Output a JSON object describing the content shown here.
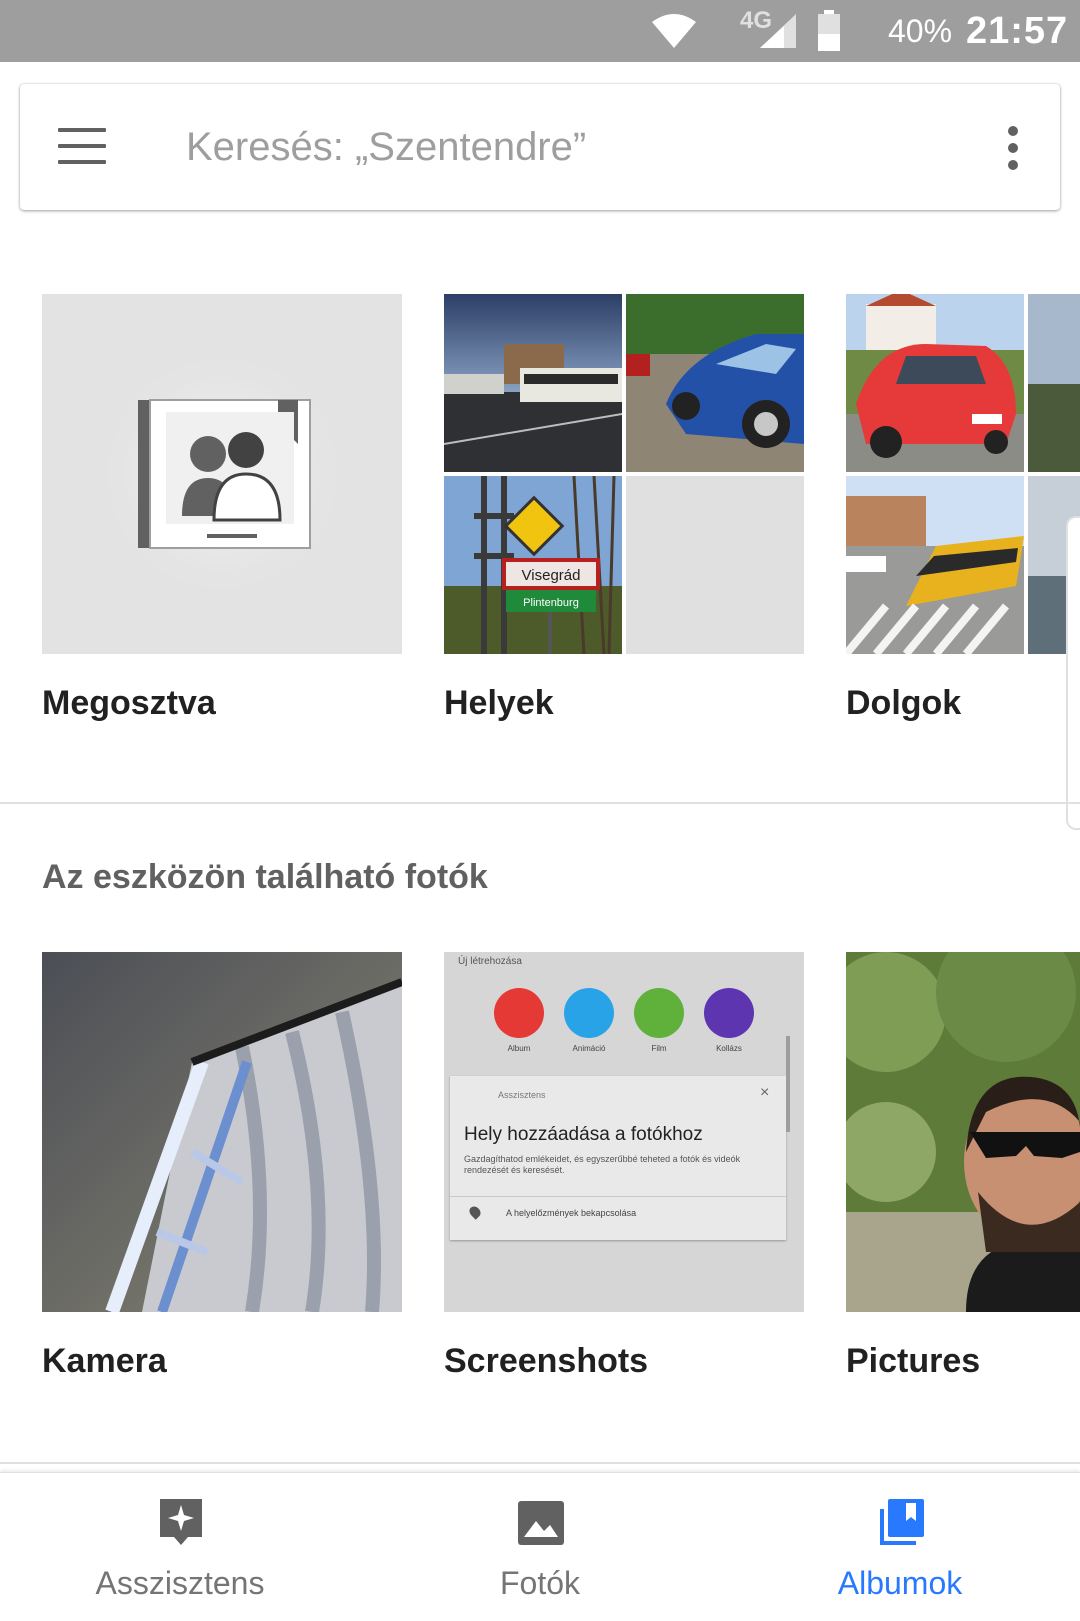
{
  "status_bar": {
    "network": "4G",
    "battery": "40%",
    "time": "21:57"
  },
  "search": {
    "placeholder": "Keresés: „Szentendre”"
  },
  "top_albums": [
    {
      "label": "Megosztva"
    },
    {
      "label": "Helyek"
    },
    {
      "label": "Dolgok"
    }
  ],
  "device_section": {
    "title": "Az eszközön található fotók",
    "albums": [
      {
        "label": "Kamera"
      },
      {
        "label": "Screenshots"
      },
      {
        "label": "Pictures"
      }
    ]
  },
  "screenshot_thumb": {
    "header": "Új létrehozása",
    "card_title": "Hely hozzáadása a fotókhoz",
    "card_body": "Gazdagíthatod emlékeidet, és egyszerűbbé teheted a fotók és videók rendezését és keresését.",
    "card_action": "A helyelőzmények bekapcsolása",
    "card_kicker": "Asszisztens",
    "chips": [
      "Album",
      "Animáció",
      "Film",
      "Kollázs"
    ]
  },
  "places_sign": {
    "line1": "Visegrád",
    "line2": "Plintenburg"
  },
  "bottom_nav": [
    {
      "label": "Asszisztens",
      "active": false
    },
    {
      "label": "Fotók",
      "active": false
    },
    {
      "label": "Albumok",
      "active": true
    }
  ],
  "colors": {
    "accent": "#2979ff",
    "status_bar": "#9e9e9e"
  }
}
